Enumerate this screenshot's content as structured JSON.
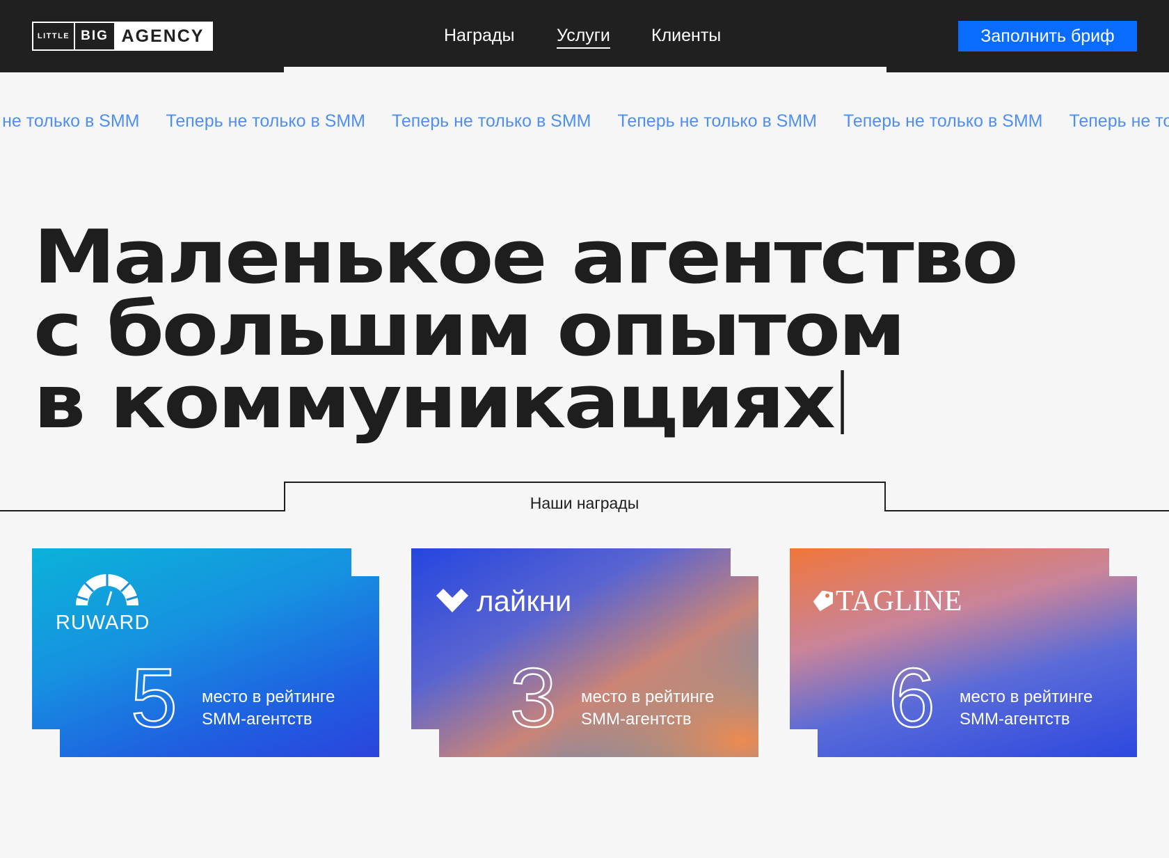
{
  "header": {
    "logo": {
      "little": "LITTLE",
      "big": "BIG",
      "agency": "AGENCY"
    },
    "nav": [
      {
        "label": "Награды"
      },
      {
        "label": "Услуги",
        "active": true
      },
      {
        "label": "Клиенты"
      }
    ],
    "cta_label": "Заполнить бриф"
  },
  "marquee": {
    "item": "Теперь не только в SMM",
    "items": [
      "Теперь не только в SMM",
      "Теперь не только в SMM",
      "Теперь не только в SMM",
      "Теперь не только в SMM",
      "Теперь не только в SMM",
      "Теперь не только в SMM"
    ]
  },
  "hero": {
    "lines": [
      "Маленькое агентство",
      "с большим опытом",
      "в коммуникациях"
    ]
  },
  "awards": {
    "section_label": "Наши награды",
    "cards": [
      {
        "brand": "RUWARD",
        "place": "5",
        "text_line1": "место  в рейтинге",
        "text_line2": "SMM-агентств"
      },
      {
        "brand": "лайкни",
        "place": "3",
        "text_line1": "место  в рейтинге",
        "text_line2": "SMM-агентств"
      },
      {
        "brand": "TAGLINE",
        "place": "6",
        "text_line1": "место  в рейтинге",
        "text_line2": "SMM-агентств"
      }
    ]
  },
  "colors": {
    "header_bg": "#202020",
    "accent": "#0a6cff",
    "marquee_text": "#4f8ff2",
    "page_bg": "#f6f6f6"
  }
}
